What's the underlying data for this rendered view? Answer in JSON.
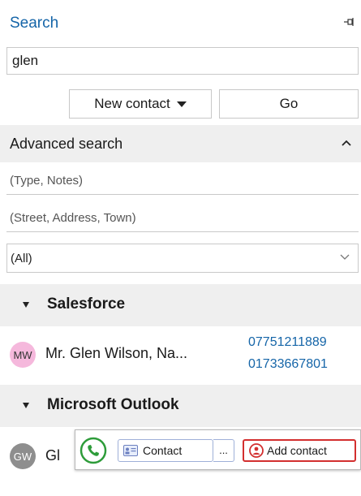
{
  "panel": {
    "title": "Search",
    "query": "glen",
    "buttons": {
      "new_contact": "New contact",
      "go": "Go"
    },
    "advanced": {
      "label": "Advanced search",
      "field1_placeholder": "(Type, Notes)",
      "field2_placeholder": "(Street, Address, Town)",
      "select_value": "(All)"
    }
  },
  "groups": [
    {
      "label": "Salesforce",
      "results": [
        {
          "initials": "MW",
          "name": "Mr. Glen Wilson, Na...",
          "phones": [
            "07751211889",
            "01733667801"
          ]
        }
      ]
    },
    {
      "label": "Microsoft Outlook",
      "results": [
        {
          "initials": "GW",
          "name": "Gl"
        }
      ]
    }
  ],
  "actions": {
    "contact": "Contact",
    "more": "...",
    "add_contact": "Add contact"
  },
  "colors": {
    "accent": "#1565a8",
    "call": "#2e9c3a",
    "add": "#d32f2f",
    "mw_avatar": "#f5b8dc",
    "gw_avatar": "#8e8e8e"
  },
  "icons": [
    "pin-icon",
    "caret-down-icon",
    "chevron-up-icon",
    "chevron-down-icon",
    "collapse-triangle-icon",
    "phone-call-icon",
    "contact-card-icon",
    "add-contact-icon"
  ]
}
